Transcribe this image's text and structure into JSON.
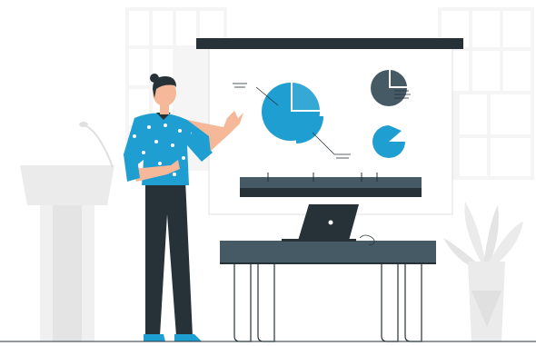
{
  "scene": {
    "kind": "illustration",
    "subject": "presenter-at-whiteboard"
  },
  "colors": {
    "accent_blue": "#1f9ed1",
    "dark_slate": "#263238",
    "mid_slate": "#455a64",
    "window_gray": "#f2f2f2",
    "podium_gray": "#ebebeb",
    "board_white": "#ffffff",
    "skin": "#f5b99a",
    "hair": "#263238"
  },
  "icons": {
    "pie_chart_large": "pie-chart-icon",
    "pie_chart_small_dark": "pie-chart-icon",
    "pie_chart_small_blue": "pie-chart-icon",
    "laptop": "laptop-icon",
    "plant": "plant-icon",
    "microphone": "microphone-icon"
  }
}
